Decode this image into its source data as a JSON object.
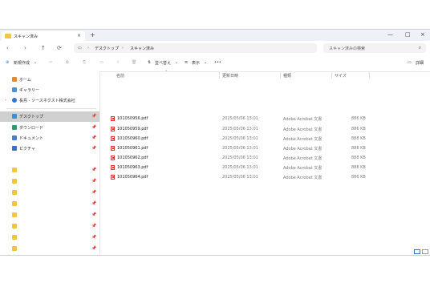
{
  "window": {
    "tab_title": "スキャン済み",
    "tab_close": "×",
    "new_tab": "+"
  },
  "controls": {
    "minimize": "—",
    "maximize": "□",
    "close": "×"
  },
  "nav": {
    "back": "‹",
    "forward": "›",
    "up": "↑",
    "refresh": "⟳"
  },
  "breadcrumb": {
    "monitor": "▭",
    "sep1": "›",
    "item1": "デスクトップ",
    "sep2": "›",
    "item2": "スキャン済み"
  },
  "search": {
    "placeholder": "スキャン済みの検索",
    "icon": "⌕"
  },
  "toolbar": {
    "new_label": "新規作成",
    "new_chevron": "⌄",
    "cut": "✂",
    "copy": "⧉",
    "paste": "⎘",
    "rename": "▭",
    "share": "⇪",
    "delete": "🗑",
    "sort_label": "並べ替え",
    "view_label": "表示",
    "more": "•••",
    "details_label": "詳細"
  },
  "sidebar": {
    "home": "ホーム",
    "gallery": "ギャラリー",
    "cloud": "長島 - ソースネクスト株式会社",
    "desktop": "デスクトップ",
    "downloads": "ダウンロード",
    "documents": "ドキュメント",
    "pictures": "ピクチャ",
    "pin": "📌",
    "expand": "›"
  },
  "columns": {
    "name": "名前",
    "date": "更新日時",
    "type": "種類",
    "size": "サイズ",
    "sort_arrow": "⌃"
  },
  "files": [
    {
      "name": "101050956.pdf",
      "date": "2025/05/06 13:01",
      "type": "Adobe Acrobat 文書",
      "size": "886 KB"
    },
    {
      "name": "101050959.pdf",
      "date": "2025/05/06 13:01",
      "type": "Adobe Acrobat 文書",
      "size": "886 KB"
    },
    {
      "name": "101050960.pdf",
      "date": "2025/05/06 13:01",
      "type": "Adobe Acrobat 文書",
      "size": "888 KB"
    },
    {
      "name": "101050961.pdf",
      "date": "2025/05/06 13:01",
      "type": "Adobe Acrobat 文書",
      "size": "888 KB"
    },
    {
      "name": "101050962.pdf",
      "date": "2025/05/06 13:01",
      "type": "Adobe Acrobat 文書",
      "size": "888 KB"
    },
    {
      "name": "101050963.pdf",
      "date": "2025/05/06 13:01",
      "type": "Adobe Acrobat 文書",
      "size": "888 KB"
    },
    {
      "name": "101050964.pdf",
      "date": "2025/05/06 13:01",
      "type": "Adobe Acrobat 文書",
      "size": "886 KB"
    }
  ],
  "colors": {
    "folder": "#f4c542",
    "pdf": "#dd3333",
    "selected": "#d0d0d0",
    "accent": "#3b74c5"
  }
}
